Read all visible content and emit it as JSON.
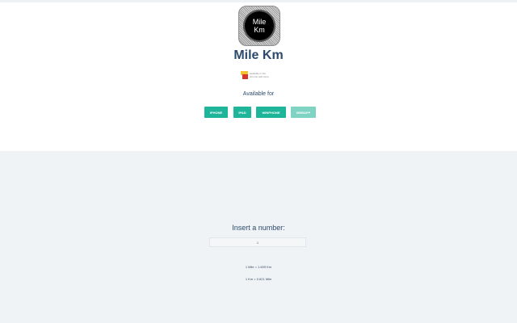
{
  "app": {
    "icon_text_line1": "Mile",
    "icon_text_line2": "Km",
    "title": "Mile Km",
    "store_badge_line1": "available in the",
    "store_badge_line2": "chrome web store"
  },
  "platforms": {
    "heading": "Available for",
    "buttons": [
      {
        "label": "IPHONE"
      },
      {
        "label": "IPAD"
      },
      {
        "label": "WINPHONE"
      },
      {
        "label": "WEBAPP"
      }
    ]
  },
  "converter": {
    "prompt": "Insert a number:",
    "input_value": "1",
    "result_mile_to_km": "1 Mile = 1.609 Km",
    "result_km_to_mile": "1 Km = 0.621 Mile"
  },
  "colors": {
    "accent": "#1fb59a",
    "accent_light": "#7fd3c2",
    "text_dark_blue": "#2d4a6b",
    "section_bg": "#f0f3f6"
  }
}
